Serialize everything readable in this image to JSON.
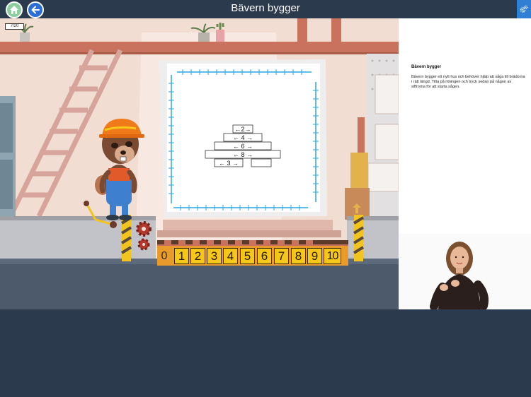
{
  "header": {
    "title": "Bävern bygger",
    "home_icon": "home-icon",
    "back_icon": "arrow-left-icon",
    "settings_icon": "gears-icon"
  },
  "game": {
    "progress": "7/20",
    "blueprint": {
      "planks": [
        "2",
        "4",
        "6",
        "8",
        "3",
        ""
      ]
    },
    "ruler": {
      "zero": "0",
      "numbers": [
        "1",
        "2",
        "3",
        "4",
        "5",
        "6",
        "7",
        "8",
        "9",
        "10"
      ]
    }
  },
  "info": {
    "title": "Bävern bygger",
    "text": "Bävern bygger ett nytt hus och behöver hjälp att såga till brädorna i rätt längd. Titta på ritningen och tryck sedan på någon av siffrorna för att starta sågen."
  },
  "colors": {
    "bar": "#2c3a4d",
    "ruler_yellow": "#f5c718",
    "ruler_orange": "#e89a2a",
    "blueprint_blue": "#29a8e0",
    "home_green": "#8ccf9e",
    "back_blue": "#2b6fd6"
  }
}
